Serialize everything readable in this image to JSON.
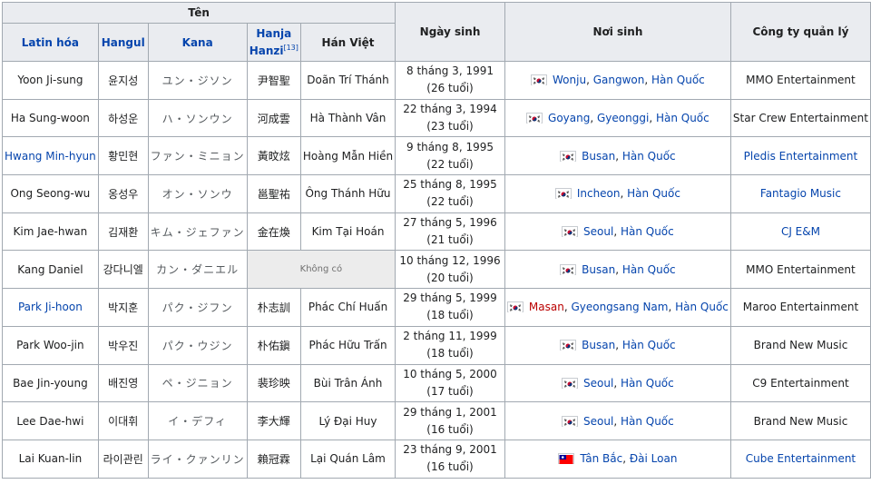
{
  "header": {
    "ten": "Tên",
    "ngay_sinh": "Ngày sinh",
    "noi_sinh": "Nơi sinh",
    "cong_ty": "Công ty quản lý",
    "latin": "Latin hóa",
    "hangul": "Hangul",
    "kana": "Kana",
    "hanja_line1": "Hanja",
    "hanja_line2": "Hanzi",
    "hanja_ref": "[13]",
    "han_viet": "Hán Việt"
  },
  "colors": {
    "header_bg": "#eaecf0",
    "border": "#a2a9b1",
    "link": "#0645ad",
    "redlink": "#ba0000",
    "none_bg": "#ececec"
  },
  "rows": [
    {
      "latin": "Yoon Ji-sung",
      "latin_link": false,
      "hangul": "윤지성",
      "kana": "ユン・ジソン",
      "hanja": "尹智聖",
      "hanviet": "Doãn Trí Thánh",
      "dob": "8 tháng 3, 1991",
      "age": "(26 tuổi)",
      "flag": "kr",
      "flag_icon": "south-korea-flag-icon",
      "place": [
        {
          "t": "Wonju",
          "s": "link"
        },
        {
          "t": ", ",
          "s": "plain"
        },
        {
          "t": "Gangwon",
          "s": "link"
        },
        {
          "t": ", ",
          "s": "plain"
        },
        {
          "t": "Hàn Quốc",
          "s": "link"
        }
      ],
      "company": "MMO Entertainment",
      "company_link": false
    },
    {
      "latin": "Ha Sung-woon",
      "latin_link": false,
      "hangul": "하성운",
      "kana": "ハ・ソンウン",
      "hanja": "河成雲",
      "hanviet": "Hà Thành Vân",
      "dob": "22 tháng 3, 1994",
      "age": "(23 tuổi)",
      "flag": "kr",
      "flag_icon": "south-korea-flag-icon",
      "place": [
        {
          "t": "Goyang",
          "s": "link"
        },
        {
          "t": ", ",
          "s": "plain"
        },
        {
          "t": "Gyeonggi",
          "s": "link"
        },
        {
          "t": ", ",
          "s": "plain"
        },
        {
          "t": "Hàn Quốc",
          "s": "link"
        }
      ],
      "company": "Star Crew Entertainment",
      "company_link": false
    },
    {
      "latin": "Hwang Min-hyun",
      "latin_link": true,
      "hangul": "황민현",
      "kana": "ファン・ミニョン",
      "hanja": "黃旼炫",
      "hanviet": "Hoàng Mẫn Hiền",
      "dob": "9 tháng 8, 1995",
      "age": "(22 tuổi)",
      "flag": "kr",
      "flag_icon": "south-korea-flag-icon",
      "place": [
        {
          "t": "Busan",
          "s": "link"
        },
        {
          "t": ", ",
          "s": "plain"
        },
        {
          "t": "Hàn Quốc",
          "s": "link"
        }
      ],
      "company": "Pledis Entertainment",
      "company_link": true
    },
    {
      "latin": "Ong Seong-wu",
      "latin_link": false,
      "hangul": "옹성우",
      "kana": "オン・ソンウ",
      "hanja": "邕聖祐",
      "hanviet": "Ông Thánh Hữu",
      "dob": "25 tháng 8, 1995",
      "age": "(22 tuổi)",
      "flag": "kr",
      "flag_icon": "south-korea-flag-icon",
      "place": [
        {
          "t": "Incheon",
          "s": "link"
        },
        {
          "t": ", ",
          "s": "plain"
        },
        {
          "t": "Hàn Quốc",
          "s": "link"
        }
      ],
      "company": "Fantagio Music",
      "company_link": true
    },
    {
      "latin": "Kim Jae-hwan",
      "latin_link": false,
      "hangul": "김재환",
      "kana": "キム・ジェファン",
      "hanja": "金在煥",
      "hanviet": "Kim Tại Hoán",
      "dob": "27 tháng 5, 1996",
      "age": "(21 tuổi)",
      "flag": "kr",
      "flag_icon": "south-korea-flag-icon",
      "place": [
        {
          "t": "Seoul",
          "s": "link"
        },
        {
          "t": ", ",
          "s": "plain"
        },
        {
          "t": "Hàn Quốc",
          "s": "link"
        }
      ],
      "company": "CJ E&M",
      "company_link": true
    },
    {
      "latin": "Kang Daniel",
      "latin_link": false,
      "hangul": "강다니엘",
      "kana": "カン・ダニエル",
      "hanja": null,
      "none_text": "Không có",
      "hanviet": null,
      "dob": "10 tháng 12, 1996",
      "age": "(20 tuổi)",
      "flag": "kr",
      "flag_icon": "south-korea-flag-icon",
      "place": [
        {
          "t": "Busan",
          "s": "link"
        },
        {
          "t": ", ",
          "s": "plain"
        },
        {
          "t": "Hàn Quốc",
          "s": "link"
        }
      ],
      "company": "MMO Entertainment",
      "company_link": false
    },
    {
      "latin": "Park Ji-hoon",
      "latin_link": true,
      "hangul": "박지훈",
      "kana": "パク・ジフン",
      "hanja": "朴志訓",
      "hanviet": "Phác Chí Huấn",
      "dob": "29 tháng 5, 1999",
      "age": "(18 tuổi)",
      "flag": "kr",
      "flag_icon": "south-korea-flag-icon",
      "place": [
        {
          "t": "Masan",
          "s": "red"
        },
        {
          "t": ", ",
          "s": "plain"
        },
        {
          "t": "Gyeongsang Nam",
          "s": "link"
        },
        {
          "t": ", ",
          "s": "plain"
        },
        {
          "t": "Hàn Quốc",
          "s": "link"
        }
      ],
      "company": "Maroo Entertainment",
      "company_link": false
    },
    {
      "latin": "Park Woo-jin",
      "latin_link": false,
      "hangul": "박우진",
      "kana": "パク・ウジン",
      "hanja": "朴佑鎭",
      "hanviet": "Phác Hữu Trấn",
      "dob": "2 tháng 11, 1999",
      "age": "(18 tuổi)",
      "flag": "kr",
      "flag_icon": "south-korea-flag-icon",
      "place": [
        {
          "t": "Busan",
          "s": "link"
        },
        {
          "t": ", ",
          "s": "plain"
        },
        {
          "t": "Hàn Quốc",
          "s": "link"
        }
      ],
      "company": "Brand New Music",
      "company_link": false
    },
    {
      "latin": "Bae Jin-young",
      "latin_link": false,
      "hangul": "배진영",
      "kana": "ペ・ジニョン",
      "hanja": "裴珍映",
      "hanviet": "Bùi Trân Ánh",
      "dob": "10 tháng 5, 2000",
      "age": "(17 tuổi)",
      "flag": "kr",
      "flag_icon": "south-korea-flag-icon",
      "place": [
        {
          "t": "Seoul",
          "s": "link"
        },
        {
          "t": ", ",
          "s": "plain"
        },
        {
          "t": "Hàn Quốc",
          "s": "link"
        }
      ],
      "company": "C9 Entertainment",
      "company_link": false
    },
    {
      "latin": "Lee Dae-hwi",
      "latin_link": false,
      "hangul": "이대휘",
      "kana": "イ・デフィ",
      "hanja": "李大輝",
      "hanviet": "Lý Đại Huy",
      "dob": "29 tháng 1, 2001",
      "age": "(16 tuổi)",
      "flag": "kr",
      "flag_icon": "south-korea-flag-icon",
      "place": [
        {
          "t": "Seoul",
          "s": "link"
        },
        {
          "t": ", ",
          "s": "plain"
        },
        {
          "t": "Hàn Quốc",
          "s": "link"
        }
      ],
      "company": "Brand New Music",
      "company_link": false
    },
    {
      "latin": "Lai Kuan-lin",
      "latin_link": false,
      "hangul": "라이관린",
      "kana": "ライ・クァンリン",
      "hanja": "賴冠霖",
      "hanviet": "Lại Quán Lâm",
      "dob": "23 tháng 9, 2001",
      "age": "(16 tuổi)",
      "flag": "tw",
      "flag_icon": "taiwan-flag-icon",
      "place": [
        {
          "t": "Tân Bắc",
          "s": "link"
        },
        {
          "t": ", ",
          "s": "plain"
        },
        {
          "t": "Đài Loan",
          "s": "link"
        }
      ],
      "company": "Cube Entertainment",
      "company_link": true
    }
  ]
}
